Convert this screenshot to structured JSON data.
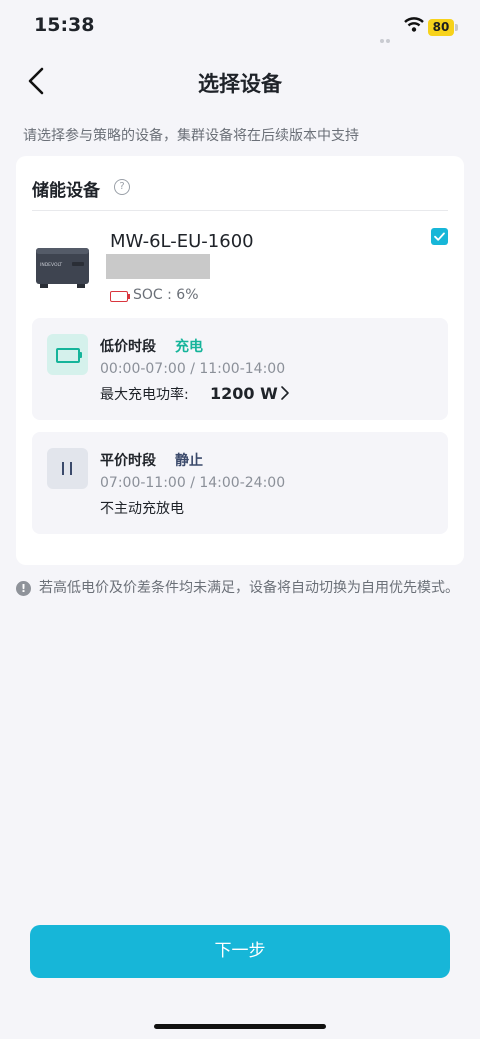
{
  "status_bar": {
    "time": "15:38",
    "battery_level": "80"
  },
  "header": {
    "title": "选择设备"
  },
  "subtitle": "请选择参与策略的设备，集群设备将在后续版本中支持",
  "section": {
    "title": "储能设备",
    "help_symbol": "?"
  },
  "device": {
    "name": "MW-6L-EU-1600",
    "soc": "SOC : 6%",
    "selected": true,
    "brand_text": "INDEVOLT"
  },
  "periods": [
    {
      "name": "低价时段",
      "status": "充电",
      "time": "00:00-07:00 / 11:00-14:00",
      "desc": "最大充电功率:",
      "power": "1200 W",
      "icon": "battery-charge-icon"
    },
    {
      "name": "平价时段",
      "status": "静止",
      "time": "07:00-11:00 / 14:00-24:00",
      "desc": "不主动充放电",
      "icon": "pause-icon"
    }
  ],
  "note": "若高低电价及价差条件均未满足，设备将自动切换为自用优先模式。",
  "note_symbol": "!",
  "next_button": "下一步",
  "colors": {
    "accent": "#17b6d8",
    "charge": "#15b49a",
    "idle": "#3b4a6b",
    "background": "#f5f5f9"
  }
}
